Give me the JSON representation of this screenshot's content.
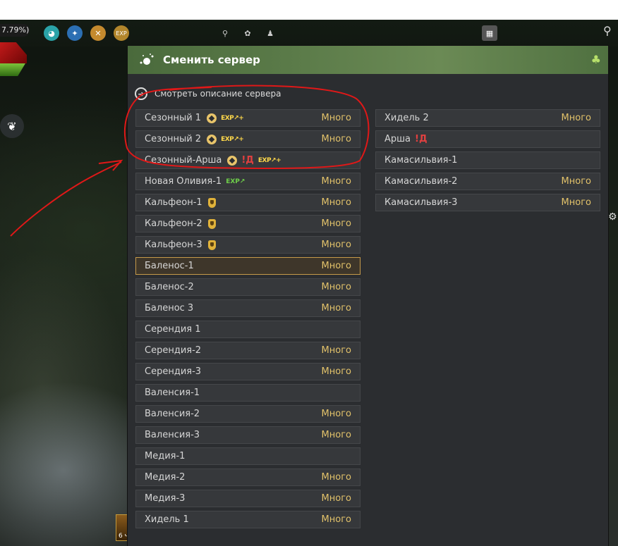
{
  "hud": {
    "percent": "7.79%)",
    "bottom_label": "6 ч"
  },
  "window": {
    "title": "Сменить сервер",
    "description_link": "Смотреть описание сервера"
  },
  "servers_left": [
    {
      "name": "Сезонный 1",
      "load": "Много",
      "badges": [
        "seasonal",
        "exp"
      ]
    },
    {
      "name": "Сезонный 2",
      "load": "Много",
      "badges": [
        "seasonal",
        "exp"
      ]
    },
    {
      "name": "Сезонный-Арша",
      "load": "",
      "badges": [
        "seasonal",
        "pvp",
        "exp"
      ]
    },
    {
      "name": "Новая Оливия-1",
      "load": "Много",
      "badges": [
        "exp-green"
      ]
    },
    {
      "name": "Кальфеон-1",
      "load": "Много",
      "badges": [
        "shield"
      ]
    },
    {
      "name": "Кальфеон-2",
      "load": "Много",
      "badges": [
        "shield"
      ]
    },
    {
      "name": "Кальфеон-3",
      "load": "Много",
      "badges": [
        "shield"
      ]
    },
    {
      "name": "Баленос-1",
      "load": "Много",
      "badges": [],
      "selected": true
    },
    {
      "name": "Баленос-2",
      "load": "Много",
      "badges": []
    },
    {
      "name": "Баленос 3",
      "load": "Много",
      "badges": []
    },
    {
      "name": "Серендия 1",
      "load": "",
      "badges": []
    },
    {
      "name": "Серендия-2",
      "load": "Много",
      "badges": []
    },
    {
      "name": "Серендия-3",
      "load": "Много",
      "badges": []
    },
    {
      "name": "Валенсия-1",
      "load": "",
      "badges": []
    },
    {
      "name": "Валенсия-2",
      "load": "Много",
      "badges": []
    },
    {
      "name": "Валенсия-3",
      "load": "Много",
      "badges": []
    },
    {
      "name": "Медия-1",
      "load": "",
      "badges": []
    },
    {
      "name": "Медия-2",
      "load": "Много",
      "badges": []
    },
    {
      "name": "Медия-3",
      "load": "Много",
      "badges": []
    },
    {
      "name": "Хидель 1",
      "load": "Много",
      "badges": []
    }
  ],
  "servers_right": [
    {
      "name": "Хидель 2",
      "load": "Много",
      "badges": []
    },
    {
      "name": "Арша",
      "load": "",
      "badges": [
        "pvp"
      ]
    },
    {
      "name": "Камасильвия-1",
      "load": "",
      "badges": []
    },
    {
      "name": "Камасильвия-2",
      "load": "Много",
      "badges": []
    },
    {
      "name": "Камасильвия-3",
      "load": "Много",
      "badges": []
    }
  ],
  "badge_text": {
    "exp": "EXP↗+",
    "exp_green": "EXP↗",
    "pvp": "!Д"
  },
  "colors": {
    "header_green": "#5b7b49",
    "load_gold": "#e2c26a",
    "selected_border": "#c69a4a",
    "annotation_red": "#e01818"
  },
  "icons": [
    "arrow-right-circle-icon",
    "clover-icon",
    "sparkle-icon",
    "butterfly-icon",
    "search-icon",
    "gear-icon"
  ]
}
